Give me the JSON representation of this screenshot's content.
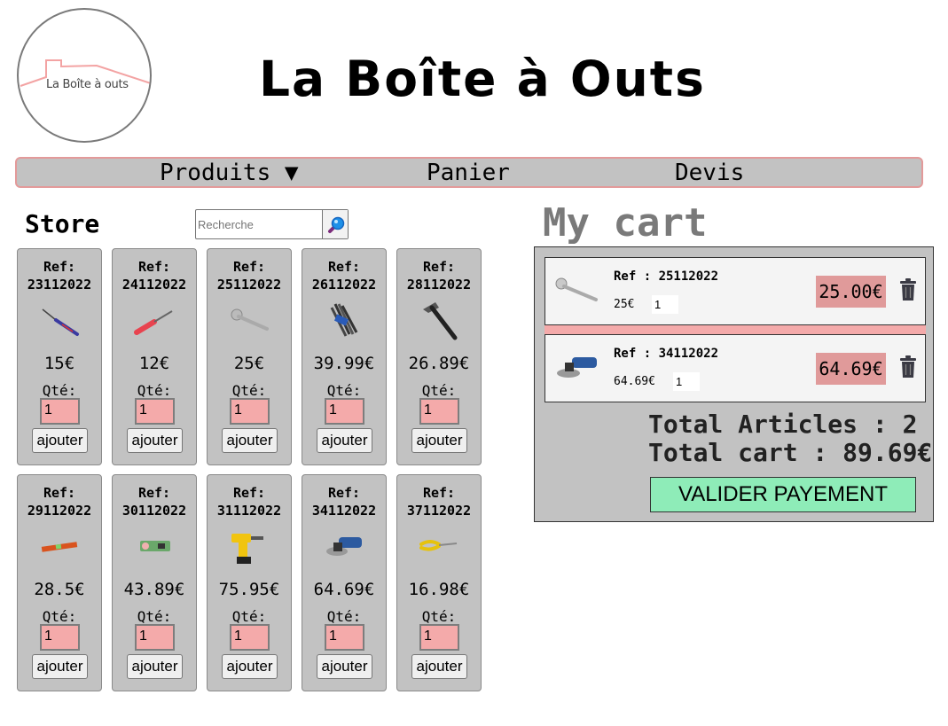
{
  "site": {
    "logo_text": "La Boîte à outs",
    "title": "La Boîte à Outs"
  },
  "nav": {
    "produits": "Produits ▼",
    "panier": "Panier",
    "devis": "Devis"
  },
  "store": {
    "title": "Store",
    "search_placeholder": "Recherche"
  },
  "products": [
    {
      "ref_label": "Ref:",
      "ref": "23112022",
      "price": "15€",
      "qte_label": "Qté:",
      "qty": "1",
      "button": "ajouter",
      "icon": "screwdriver-icon"
    },
    {
      "ref_label": "Ref:",
      "ref": "24112022",
      "price": "12€",
      "qte_label": "Qté:",
      "qty": "1",
      "button": "ajouter",
      "icon": "screwdriver-icon"
    },
    {
      "ref_label": "Ref:",
      "ref": "25112022",
      "price": "25€",
      "qte_label": "Qté:",
      "qty": "1",
      "button": "ajouter",
      "icon": "adjustable-wrench-icon"
    },
    {
      "ref_label": "Ref:",
      "ref": "26112022",
      "price": "39.99€",
      "qte_label": "Qté:",
      "qty": "1",
      "button": "ajouter",
      "icon": "hex-key-set-icon"
    },
    {
      "ref_label": "Ref:",
      "ref": "28112022",
      "price": "26.89€",
      "qte_label": "Qté:",
      "qty": "1",
      "button": "ajouter",
      "icon": "hammer-icon"
    },
    {
      "ref_label": "Ref:",
      "ref": "29112022",
      "price": "28.5€",
      "qte_label": "Qté:",
      "qty": "1",
      "button": "ajouter",
      "icon": "spirit-level-icon"
    },
    {
      "ref_label": "Ref:",
      "ref": "30112022",
      "price": "43.89€",
      "qte_label": "Qté:",
      "qty": "1",
      "button": "ajouter",
      "icon": "circuit-tester-icon"
    },
    {
      "ref_label": "Ref:",
      "ref": "31112022",
      "price": "75.95€",
      "qte_label": "Qté:",
      "qty": "1",
      "button": "ajouter",
      "icon": "cordless-drill-icon"
    },
    {
      "ref_label": "Ref:",
      "ref": "34112022",
      "price": "64.69€",
      "qte_label": "Qté:",
      "qty": "1",
      "button": "ajouter",
      "icon": "angle-grinder-icon"
    },
    {
      "ref_label": "Ref:",
      "ref": "37112022",
      "price": "16.98€",
      "qte_label": "Qté:",
      "qty": "1",
      "button": "ajouter",
      "icon": "pliers-icon"
    }
  ],
  "cart": {
    "title": "My cart",
    "items": [
      {
        "ref": "Ref : 25112022",
        "unit_price": "25€",
        "qty": "1",
        "total": "25.00€",
        "icon": "adjustable-wrench-icon"
      },
      {
        "ref": "Ref : 34112022",
        "unit_price": "64.69€",
        "qty": "1",
        "total": "64.69€",
        "icon": "angle-grinder-icon"
      }
    ],
    "total_articles": "Total Articles : 2",
    "total_cart": "Total cart : 89.69€",
    "validate_button": "VALIDER PAYEMENT"
  },
  "colors": {
    "panel_gray": "#c2c2c2",
    "pink_accent": "#f4aaaa",
    "price_badge": "#e09a9a",
    "validate_green": "#8eecb8"
  }
}
